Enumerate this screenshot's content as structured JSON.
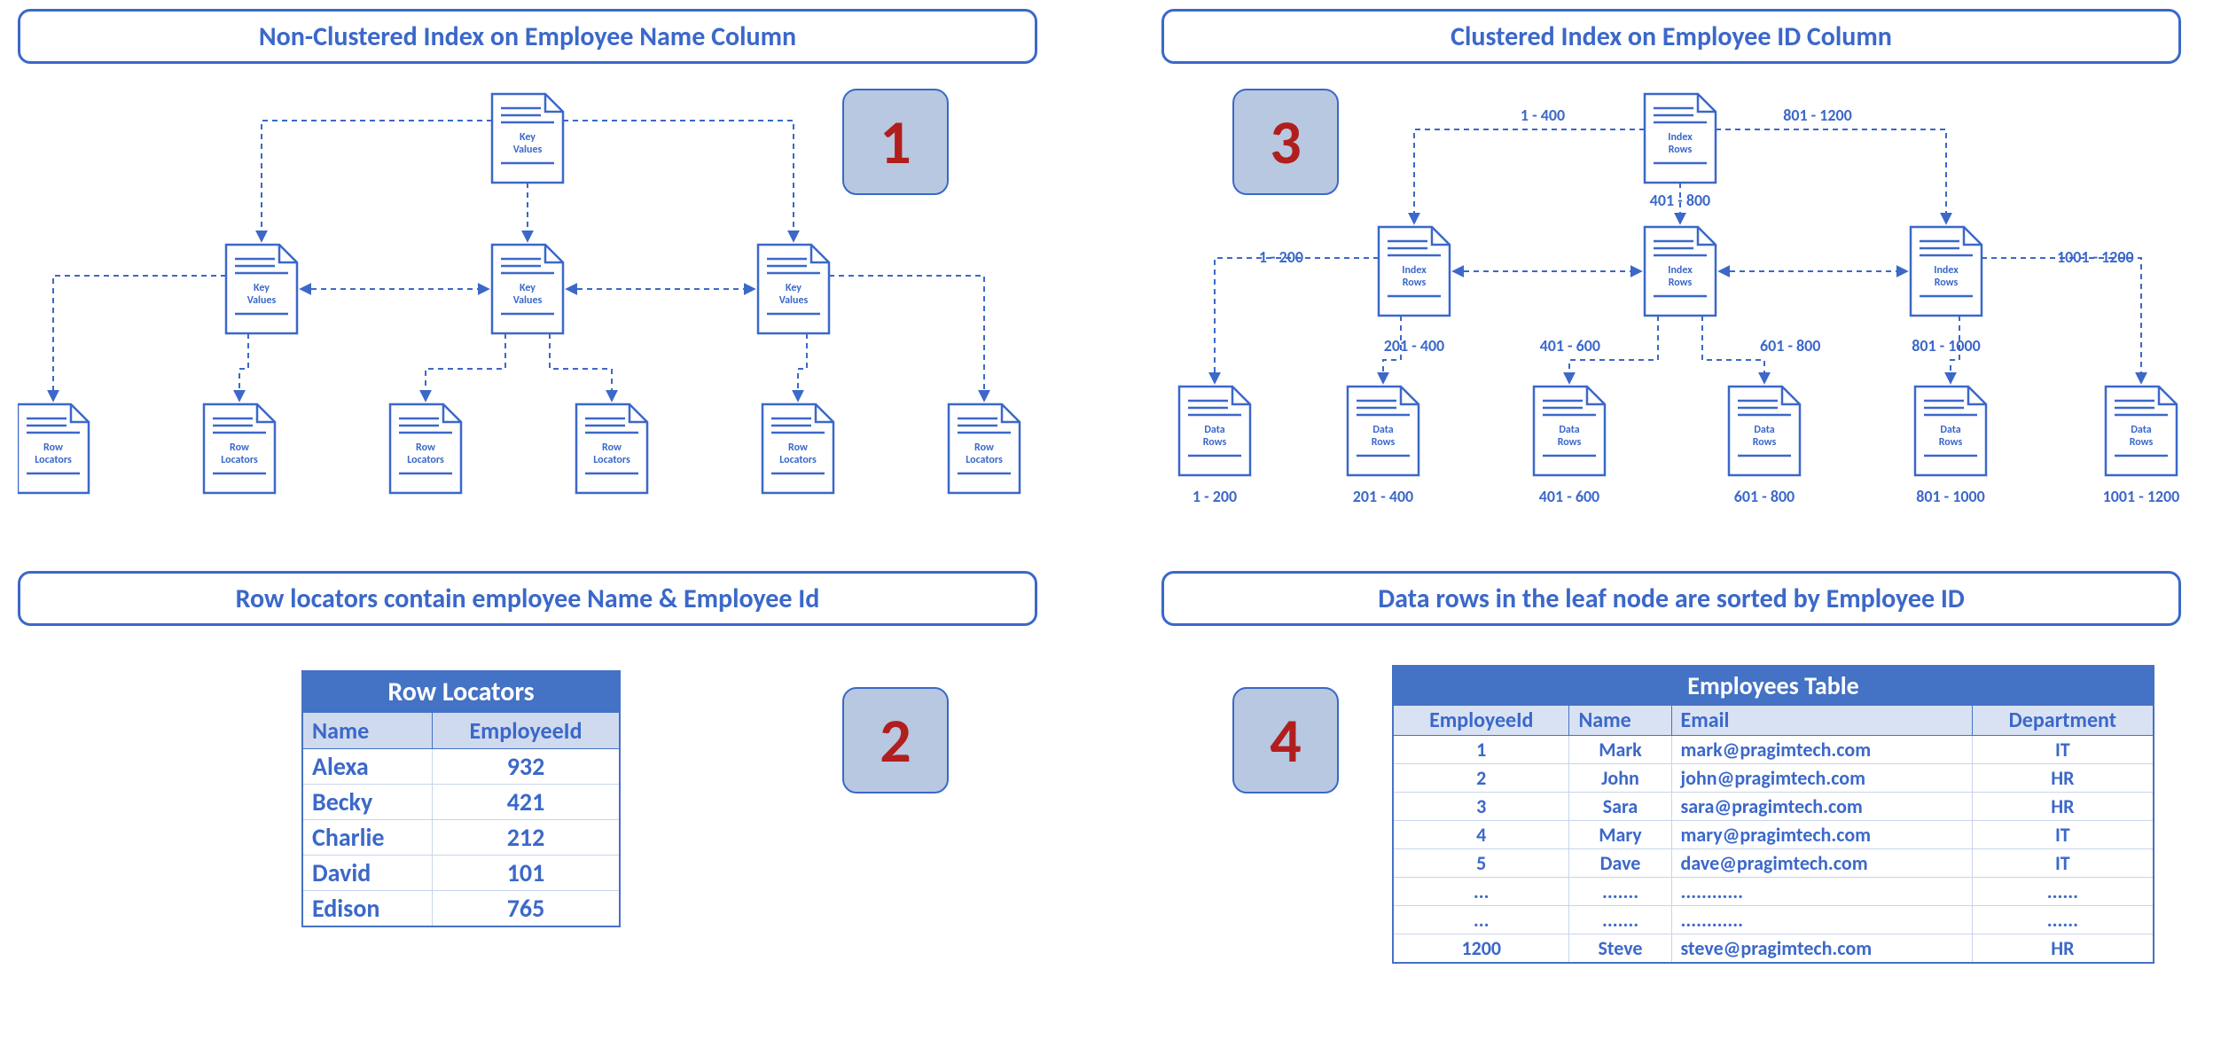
{
  "colors": {
    "primary": "#3b68c9",
    "badgeBg": "#b7c8e0",
    "badgeText": "#b11e1e",
    "headerBg": "#4472c4"
  },
  "left": {
    "title1": "Non-Clustered Index on Employee Name Column",
    "title2": "Row locators contain employee Name & Employee Id",
    "badge1": "1",
    "badge2": "2",
    "doc_root": "Key Values",
    "doc_mid": "Key Values",
    "doc_leaf": "Row Locators",
    "row_locators": {
      "title": "Row Locators",
      "cols": [
        "Name",
        "EmployeeId"
      ],
      "rows": [
        [
          "Alexa",
          "932"
        ],
        [
          "Becky",
          "421"
        ],
        [
          "Charlie",
          "212"
        ],
        [
          "David",
          "101"
        ],
        [
          "Edison",
          "765"
        ]
      ]
    }
  },
  "right": {
    "title1": "Clustered Index on Employee ID Column",
    "title2": "Data rows in the leaf node are sorted by Employee ID",
    "badge3": "3",
    "badge4": "4",
    "doc_root": "Index Rows",
    "doc_mid": "Index Rows",
    "doc_leaf": "Data Rows",
    "ranges": {
      "top_left": "1 - 400",
      "top_mid": "401 - 800",
      "top_right": "801 - 1200",
      "mid_l_l": "1 - 200",
      "mid_l_r": "201 - 400",
      "mid_c_l": "401 - 600",
      "mid_c_r": "601 - 800",
      "mid_r_l": "801 - 1000",
      "mid_r_r": "1001 - 1200",
      "leaf": [
        "1 - 200",
        "201 - 400",
        "401 - 600",
        "601 - 800",
        "801 - 1000",
        "1001 - 1200"
      ]
    },
    "employees": {
      "title": "Employees Table",
      "cols": [
        "EmployeeId",
        "Name",
        "Email",
        "Department"
      ],
      "rows": [
        [
          "1",
          "Mark",
          "mark@pragimtech.com",
          "IT"
        ],
        [
          "2",
          "John",
          "john@pragimtech.com",
          "HR"
        ],
        [
          "3",
          "Sara",
          "sara@pragimtech.com",
          "HR"
        ],
        [
          "4",
          "Mary",
          "mary@pragimtech.com",
          "IT"
        ],
        [
          "5",
          "Dave",
          "dave@pragimtech.com",
          "IT"
        ],
        [
          "...",
          ".......",
          "............",
          "......"
        ],
        [
          "...",
          ".......",
          "............",
          "......"
        ],
        [
          "1200",
          "Steve",
          "steve@pragimtech.com",
          "HR"
        ]
      ]
    }
  }
}
